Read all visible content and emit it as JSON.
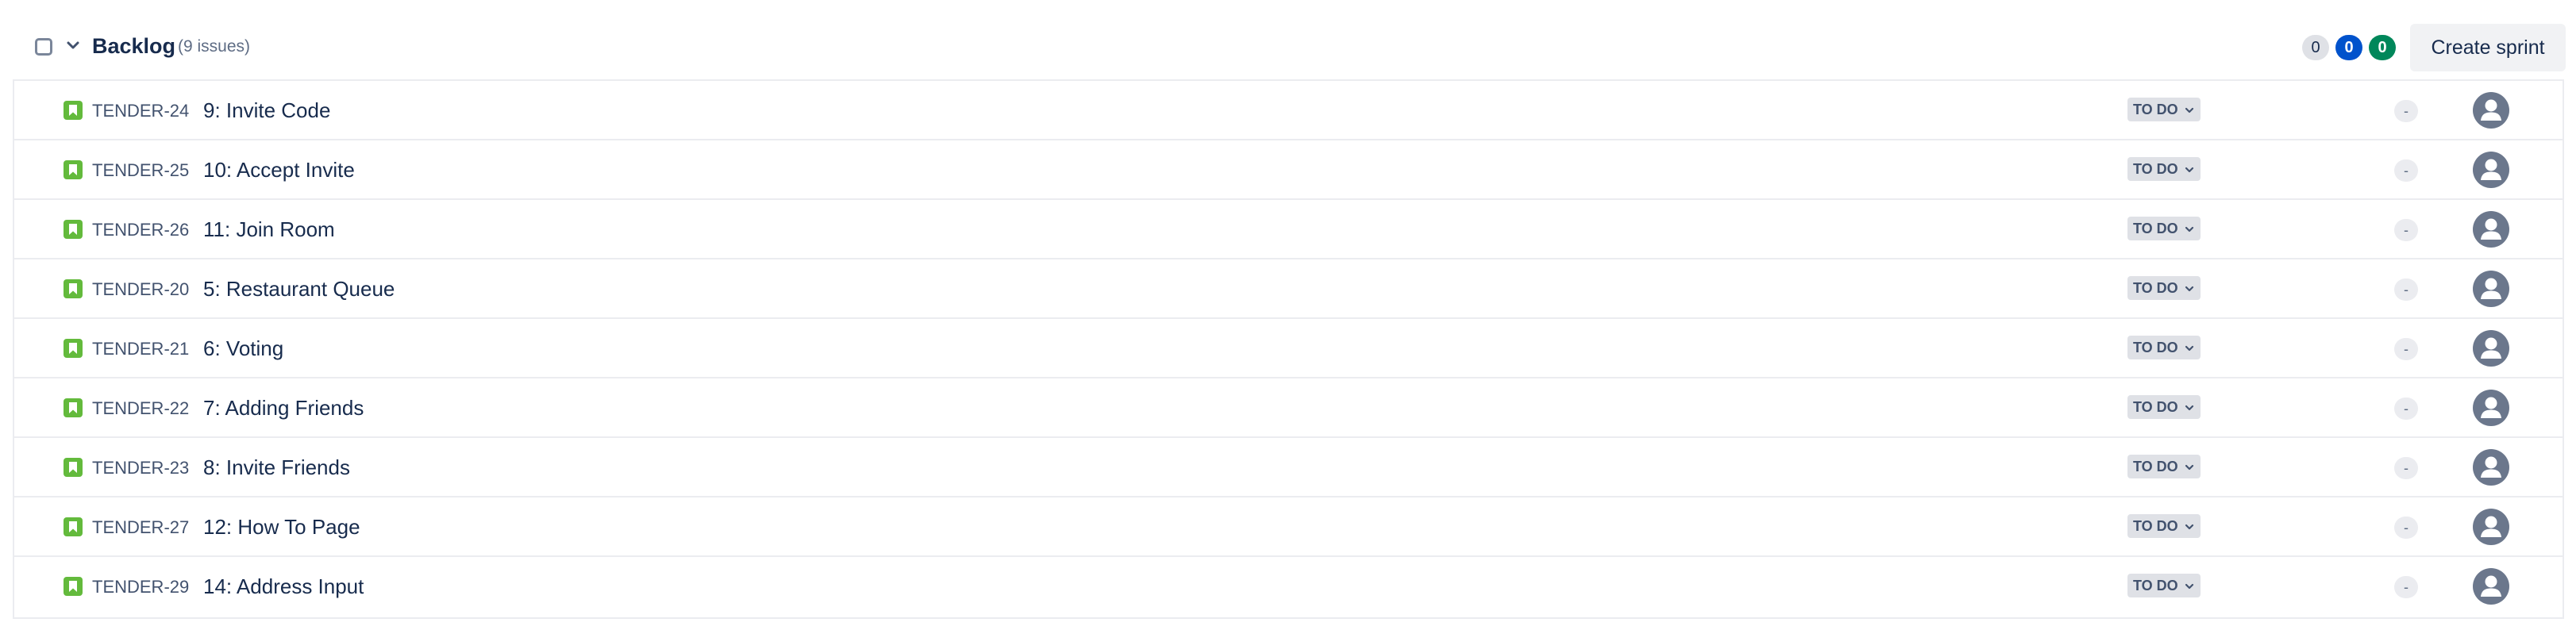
{
  "backlog": {
    "title": "Backlog",
    "issue_count": "(9 issues)",
    "counts": {
      "todo": "0",
      "in_progress": "0",
      "done": "0"
    },
    "create_sprint_label": "Create sprint",
    "colors": {
      "todo": "#dfe1e6",
      "in_progress": "#0052cc",
      "done": "#00875a",
      "story_icon": "#63ba3c"
    }
  },
  "issues": [
    {
      "key": "TENDER-24",
      "summary": "9: Invite Code",
      "status": "TO DO",
      "estimate": "-"
    },
    {
      "key": "TENDER-25",
      "summary": "10: Accept Invite",
      "status": "TO DO",
      "estimate": "-"
    },
    {
      "key": "TENDER-26",
      "summary": "11: Join Room",
      "status": "TO DO",
      "estimate": "-"
    },
    {
      "key": "TENDER-20",
      "summary": "5: Restaurant Queue",
      "status": "TO DO",
      "estimate": "-"
    },
    {
      "key": "TENDER-21",
      "summary": "6: Voting",
      "status": "TO DO",
      "estimate": "-"
    },
    {
      "key": "TENDER-22",
      "summary": "7: Adding Friends",
      "status": "TO DO",
      "estimate": "-"
    },
    {
      "key": "TENDER-23",
      "summary": "8: Invite Friends",
      "status": "TO DO",
      "estimate": "-"
    },
    {
      "key": "TENDER-27",
      "summary": "12: How To Page",
      "status": "TO DO",
      "estimate": "-"
    },
    {
      "key": "TENDER-29",
      "summary": "14: Address Input",
      "status": "TO DO",
      "estimate": "-"
    }
  ],
  "icons": {
    "issue_type": "story-bookmark-icon",
    "status_dropdown": "chevron-down-icon",
    "assignee": "unassigned-avatar-icon"
  }
}
